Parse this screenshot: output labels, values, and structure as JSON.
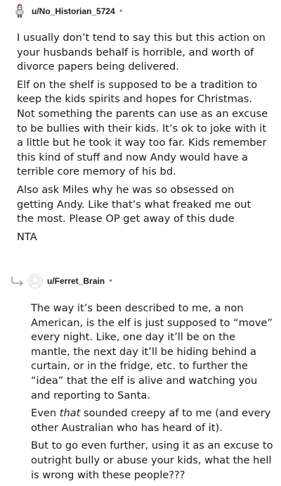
{
  "comments": [
    {
      "username": "u/No_Historian_5724",
      "separator": "•",
      "avatar_icon": "snoo-avatar-icon",
      "paragraphs": [
        "I usually don’t tend to say this but this action on your husbands behalf is horrible, and worth of divorce papers being delivered.",
        "Elf on the shelf is supposed to be a tradition to keep the kids spirits and hopes for Christmas. Not something the parents can use as an excuse to be bullies with their kids. It’s ok to joke with it a little but he took it way too far. Kids remember this kind of stuff and now Andy would have a terrible core memory of his bd.",
        "Also ask Miles why he was so obsessed on getting Andy. Like that’s what freaked me out the most. Please OP get away of this dude",
        "NTA"
      ]
    },
    {
      "username": "u/Ferret_Brain",
      "separator": "•",
      "avatar_icon": "default-avatar-icon",
      "reply_icon": "reply-arrow-icon",
      "paragraphs": [
        "The way it’s been described to me, a non American, is the elf is just supposed to “move” every night. Like, one day it’ll be on the mantle, the next day it’ll be hiding behind a curtain, or in the fridge, etc. to further the “idea” that the elf is alive and watching you and reporting to Santa.",
        {
          "before": "Even ",
          "emphasis": "that",
          "after": " sounded creepy af to me (and every other Australian who has heard of it)."
        },
        "But to go even further, using it as an excuse to outright bully or abuse your kids, what the hell is wrong with these people???"
      ]
    }
  ]
}
